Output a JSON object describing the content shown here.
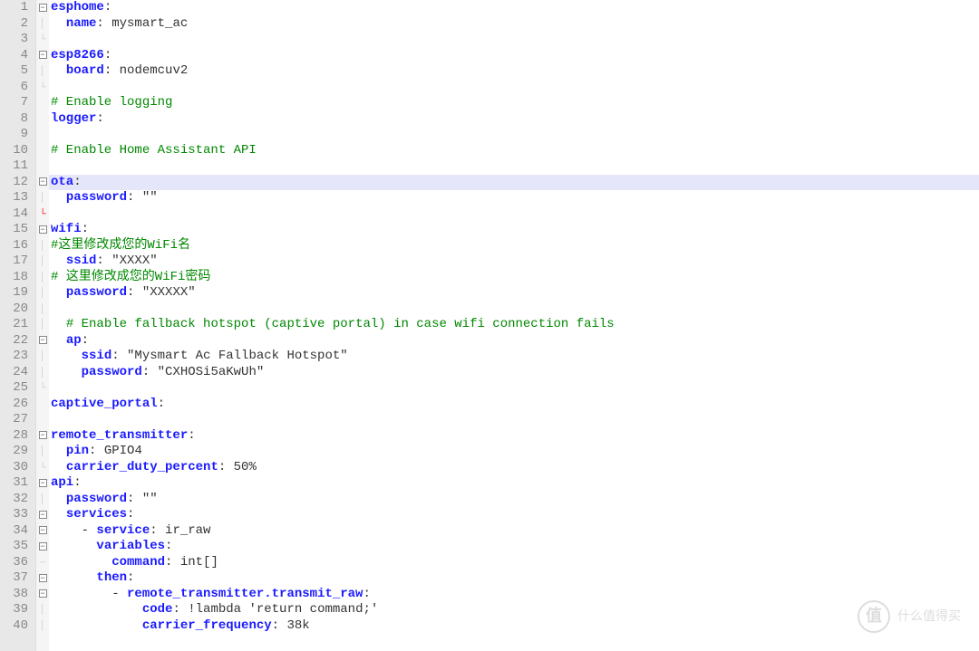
{
  "watermark_text": "什么值得买",
  "watermark_icon": "值",
  "lines": [
    {
      "n": 1,
      "fold": "[-]",
      "tokens": [
        {
          "t": "esphome",
          "c": "key"
        },
        {
          "t": ":",
          "c": "punct"
        }
      ]
    },
    {
      "n": 2,
      "fold": "|",
      "tokens": [
        {
          "t": "  ",
          "c": ""
        },
        {
          "t": "name",
          "c": "key"
        },
        {
          "t": ":",
          "c": "punct"
        },
        {
          "t": " mysmart_ac",
          "c": "value"
        }
      ]
    },
    {
      "n": 3,
      "fold": "L",
      "tokens": [
        {
          "t": "",
          "c": ""
        }
      ]
    },
    {
      "n": 4,
      "fold": "[-]",
      "tokens": [
        {
          "t": "esp8266",
          "c": "key"
        },
        {
          "t": ":",
          "c": "punct"
        }
      ]
    },
    {
      "n": 5,
      "fold": "|",
      "tokens": [
        {
          "t": "  ",
          "c": ""
        },
        {
          "t": "board",
          "c": "key"
        },
        {
          "t": ":",
          "c": "punct"
        },
        {
          "t": " nodemcuv2",
          "c": "value"
        }
      ]
    },
    {
      "n": 6,
      "fold": "L",
      "tokens": [
        {
          "t": "",
          "c": ""
        }
      ]
    },
    {
      "n": 7,
      "fold": "",
      "tokens": [
        {
          "t": "# Enable logging",
          "c": "comment"
        }
      ]
    },
    {
      "n": 8,
      "fold": "",
      "tokens": [
        {
          "t": "logger",
          "c": "key"
        },
        {
          "t": ":",
          "c": "punct"
        }
      ]
    },
    {
      "n": 9,
      "fold": "",
      "tokens": [
        {
          "t": "",
          "c": ""
        }
      ]
    },
    {
      "n": 10,
      "fold": "",
      "tokens": [
        {
          "t": "# Enable Home Assistant API",
          "c": "comment"
        }
      ]
    },
    {
      "n": 11,
      "fold": "",
      "tokens": [
        {
          "t": "",
          "c": ""
        }
      ]
    },
    {
      "n": 12,
      "fold": "[-]",
      "hilite": true,
      "cursor": true,
      "tokens": [
        {
          "t": "ota",
          "c": "key"
        },
        {
          "t": ":",
          "c": "punct"
        }
      ]
    },
    {
      "n": 13,
      "fold": "|",
      "tokens": [
        {
          "t": "  ",
          "c": ""
        },
        {
          "t": "password",
          "c": "key"
        },
        {
          "t": ":",
          "c": "punct"
        },
        {
          "t": " \"\"",
          "c": "value"
        }
      ]
    },
    {
      "n": 14,
      "fold": "Lr",
      "tokens": [
        {
          "t": "",
          "c": ""
        }
      ]
    },
    {
      "n": 15,
      "fold": "[-]",
      "tokens": [
        {
          "t": "wifi",
          "c": "key"
        },
        {
          "t": ":",
          "c": "punct"
        }
      ]
    },
    {
      "n": 16,
      "fold": "|",
      "tokens": [
        {
          "t": "#这里修改成您的WiFi名",
          "c": "comment"
        }
      ]
    },
    {
      "n": 17,
      "fold": "|",
      "tokens": [
        {
          "t": "  ",
          "c": ""
        },
        {
          "t": "ssid",
          "c": "key"
        },
        {
          "t": ":",
          "c": "punct"
        },
        {
          "t": " \"XXXX\"",
          "c": "value"
        }
      ]
    },
    {
      "n": 18,
      "fold": "|",
      "tokens": [
        {
          "t": "# 这里修改成您的WiFi密码",
          "c": "comment"
        }
      ]
    },
    {
      "n": 19,
      "fold": "|",
      "tokens": [
        {
          "t": "  ",
          "c": ""
        },
        {
          "t": "password",
          "c": "key"
        },
        {
          "t": ":",
          "c": "punct"
        },
        {
          "t": " \"XXXXX\"",
          "c": "value"
        }
      ]
    },
    {
      "n": 20,
      "fold": "|",
      "tokens": [
        {
          "t": "",
          "c": ""
        }
      ]
    },
    {
      "n": 21,
      "fold": "|",
      "tokens": [
        {
          "t": "  ",
          "c": ""
        },
        {
          "t": "# Enable fallback hotspot (captive portal) in case wifi connection fails",
          "c": "comment"
        }
      ]
    },
    {
      "n": 22,
      "fold": "[-]",
      "tokens": [
        {
          "t": "  ",
          "c": ""
        },
        {
          "t": "ap",
          "c": "key"
        },
        {
          "t": ":",
          "c": "punct"
        }
      ]
    },
    {
      "n": 23,
      "fold": "|",
      "tokens": [
        {
          "t": "    ",
          "c": ""
        },
        {
          "t": "ssid",
          "c": "key"
        },
        {
          "t": ":",
          "c": "punct"
        },
        {
          "t": " \"Mysmart Ac Fallback Hotspot\"",
          "c": "value"
        }
      ]
    },
    {
      "n": 24,
      "fold": "|",
      "tokens": [
        {
          "t": "    ",
          "c": ""
        },
        {
          "t": "password",
          "c": "key"
        },
        {
          "t": ":",
          "c": "punct"
        },
        {
          "t": " \"CXHOSi5aKwUh\"",
          "c": "value"
        }
      ]
    },
    {
      "n": 25,
      "fold": "L",
      "tokens": [
        {
          "t": "",
          "c": ""
        }
      ]
    },
    {
      "n": 26,
      "fold": "",
      "tokens": [
        {
          "t": "captive_portal",
          "c": "key"
        },
        {
          "t": ":",
          "c": "punct"
        }
      ]
    },
    {
      "n": 27,
      "fold": "",
      "tokens": [
        {
          "t": "",
          "c": ""
        }
      ]
    },
    {
      "n": 28,
      "fold": "[-]",
      "tokens": [
        {
          "t": "remote_transmitter",
          "c": "key"
        },
        {
          "t": ":",
          "c": "punct"
        }
      ]
    },
    {
      "n": 29,
      "fold": "|",
      "tokens": [
        {
          "t": "  ",
          "c": ""
        },
        {
          "t": "pin",
          "c": "key"
        },
        {
          "t": ":",
          "c": "punct"
        },
        {
          "t": " GPIO4",
          "c": "value"
        }
      ]
    },
    {
      "n": 30,
      "fold": "L",
      "tokens": [
        {
          "t": "  ",
          "c": ""
        },
        {
          "t": "carrier_duty_percent",
          "c": "key"
        },
        {
          "t": ":",
          "c": "punct"
        },
        {
          "t": " 50%",
          "c": "value"
        }
      ]
    },
    {
      "n": 31,
      "fold": "[-]",
      "tokens": [
        {
          "t": "api",
          "c": "key"
        },
        {
          "t": ":",
          "c": "punct"
        }
      ]
    },
    {
      "n": 32,
      "fold": "|",
      "tokens": [
        {
          "t": "  ",
          "c": ""
        },
        {
          "t": "password",
          "c": "key"
        },
        {
          "t": ":",
          "c": "punct"
        },
        {
          "t": " \"\"",
          "c": "value"
        }
      ]
    },
    {
      "n": 33,
      "fold": "[-]",
      "tokens": [
        {
          "t": "  ",
          "c": ""
        },
        {
          "t": "services",
          "c": "key"
        },
        {
          "t": ":",
          "c": "punct"
        }
      ]
    },
    {
      "n": 34,
      "fold": "[-]",
      "tokens": [
        {
          "t": "    - ",
          "c": "value"
        },
        {
          "t": "service",
          "c": "key"
        },
        {
          "t": ":",
          "c": "punct"
        },
        {
          "t": " ir_raw",
          "c": "value"
        }
      ]
    },
    {
      "n": 35,
      "fold": "[-]",
      "tokens": [
        {
          "t": "      ",
          "c": ""
        },
        {
          "t": "variables",
          "c": "key"
        },
        {
          "t": ":",
          "c": "punct"
        }
      ]
    },
    {
      "n": 36,
      "fold": "-",
      "tokens": [
        {
          "t": "        ",
          "c": ""
        },
        {
          "t": "command",
          "c": "key"
        },
        {
          "t": ":",
          "c": "punct"
        },
        {
          "t": " int[]",
          "c": "value"
        }
      ]
    },
    {
      "n": 37,
      "fold": "[-]",
      "tokens": [
        {
          "t": "      ",
          "c": ""
        },
        {
          "t": "then",
          "c": "key"
        },
        {
          "t": ":",
          "c": "punct"
        }
      ]
    },
    {
      "n": 38,
      "fold": "[-]",
      "tokens": [
        {
          "t": "        - ",
          "c": "value"
        },
        {
          "t": "remote_transmitter.transmit_raw",
          "c": "key"
        },
        {
          "t": ":",
          "c": "punct"
        }
      ]
    },
    {
      "n": 39,
      "fold": "|",
      "tokens": [
        {
          "t": "            ",
          "c": ""
        },
        {
          "t": "code",
          "c": "key"
        },
        {
          "t": ":",
          "c": "punct"
        },
        {
          "t": " !lambda 'return command;'",
          "c": "value"
        }
      ]
    },
    {
      "n": 40,
      "fold": "|",
      "tokens": [
        {
          "t": "            ",
          "c": ""
        },
        {
          "t": "carrier_frequency",
          "c": "key"
        },
        {
          "t": ":",
          "c": "punct"
        },
        {
          "t": " 38k",
          "c": "value"
        }
      ]
    }
  ]
}
